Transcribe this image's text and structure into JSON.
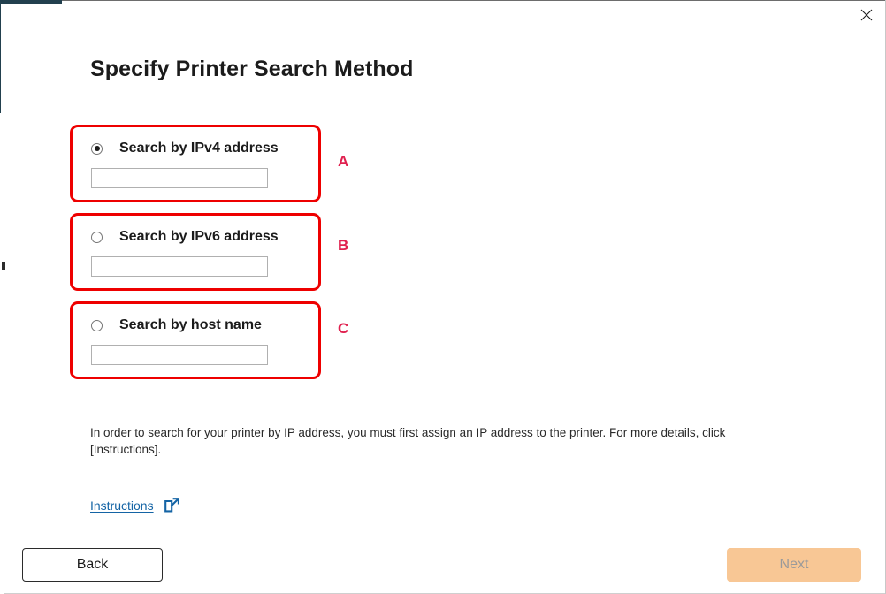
{
  "window": {
    "close_label": "×",
    "accent_color": "#22404e"
  },
  "page": {
    "title": "Specify Printer Search Method"
  },
  "options": [
    {
      "id": "ipv4",
      "label": "Search by IPv4 address",
      "selected": true,
      "value": "",
      "placeholder": "",
      "annotation": "A"
    },
    {
      "id": "ipv6",
      "label": "Search by IPv6 address",
      "selected": false,
      "value": "",
      "placeholder": "",
      "annotation": "B"
    },
    {
      "id": "hostname",
      "label": "Search by host name",
      "selected": false,
      "value": "",
      "placeholder": "",
      "annotation": "C"
    }
  ],
  "annotations": {
    "a": "A",
    "b": "B",
    "c": "C",
    "color": "#e0214f",
    "box_color": "#ee0000"
  },
  "description": {
    "text": "In order to search for your printer by IP address, you must first assign an IP address to the printer. For more details, click [Instructions]."
  },
  "instructions": {
    "label": "Instructions",
    "icon": "external-link-icon",
    "color": "#1464a5"
  },
  "footer": {
    "back_label": "Back",
    "next_label": "Next",
    "next_enabled": false,
    "next_color": "#f8c795"
  }
}
